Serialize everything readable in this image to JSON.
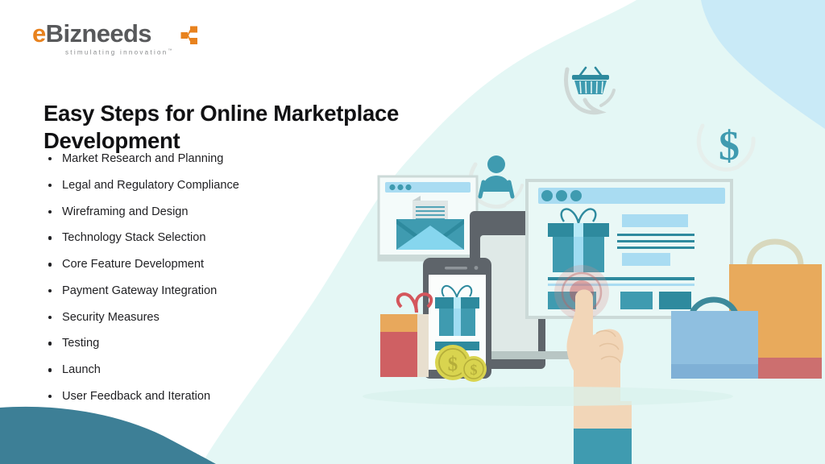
{
  "brand": {
    "wordmark_prefix": "e",
    "wordmark_rest": "Bizneeds",
    "tagline": "stimulating innovation",
    "tagline_tm": "™",
    "mark_icon": "network-share-icon",
    "accent_orange": "#e8821e",
    "wordmark_gray": "#58595b"
  },
  "headline": "Easy Steps for Online Marketplace Development",
  "steps": [
    "Market Research and Planning",
    "Legal and Regulatory Compliance",
    "Wireframing and Design",
    "Technology Stack Selection",
    "Core Feature Development",
    "Payment Gateway Integration",
    "Security Measures",
    "Testing",
    "Launch",
    "User Feedback and Iteration"
  ],
  "illustration": {
    "description": "Online marketplace e-commerce flat illustration",
    "elements": [
      "shopping-basket-bubble-icon",
      "dollar-sign-bubble-icon",
      "user-avatar-bubble-icon",
      "email-browser-window",
      "desktop-monitor",
      "product-browser-window",
      "gift-box-graphic",
      "smartphone-with-gift",
      "gift-package-red",
      "gold-coins",
      "pointing-hand",
      "shopping-bag-orange",
      "shopping-bag-blue"
    ],
    "coin_symbol": "$",
    "bubble_dollar_symbol": "$"
  },
  "colors": {
    "page_background": "#ffffff",
    "mint_panel": "#e4f7f5",
    "sky_corner": "#c5e8f7",
    "teal_arc": "#3d7f96",
    "teal_dark": "#2e8a9e",
    "teal_mid": "#3f9bb0",
    "light_blue": "#9fdcf2",
    "orange_bag": "#e8aa5c",
    "red_band": "#cc6f6f",
    "blue_bag": "#8fbfe0",
    "skin": "#f2d6b8",
    "gold_coin": "#e2dd62",
    "gray_device": "#5e646a"
  }
}
